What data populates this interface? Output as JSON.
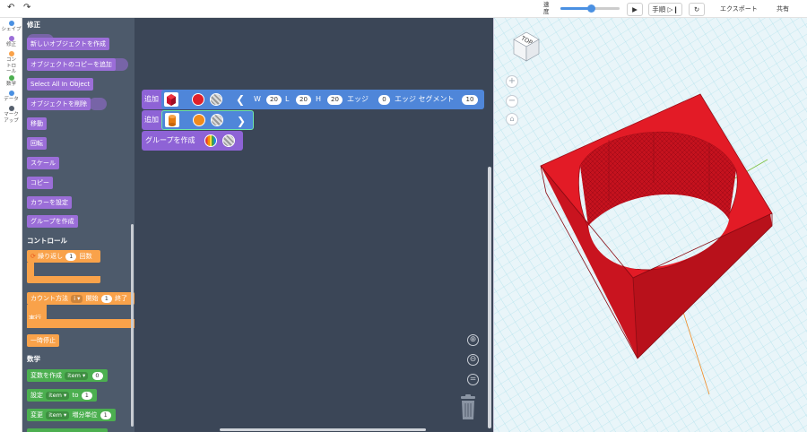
{
  "toolbar": {
    "undo_icon": "undo-arrow",
    "redo_icon": "redo-arrow",
    "speed_label": "速度",
    "speed_percent": 52,
    "play_icon": "play-triangle",
    "step_label": "手順",
    "step_icon": "step-forward",
    "reset_icon": "reset-circle",
    "export_label": "エクスポート",
    "share_label": "共有"
  },
  "categories": [
    {
      "label": "シェイプ",
      "color": "#4a90e2"
    },
    {
      "label": "修正",
      "color": "#9b6ed8"
    },
    {
      "label": "コントロール",
      "color": "#f9a24a"
    },
    {
      "label": "数学",
      "color": "#4caf50"
    },
    {
      "label": "データ",
      "color": "#4a90e2"
    },
    {
      "label": "マークアップ",
      "color": "#555f6d"
    }
  ],
  "flyout": {
    "modify_title": "修正",
    "modify_blocks": [
      "新しいオブジェクトを作成",
      "オブジェクトのコピーを追加",
      "Select All In Object",
      "オブジェクトを削除",
      "移動",
      "回転",
      "スケール",
      "コピー",
      "カラーを設定",
      "グループを作成"
    ],
    "control_title": "コントロール",
    "repeat_label": "繰り返し",
    "repeat_count": "1",
    "repeat_suffix": "回数",
    "count_label": "カウント方法",
    "count_var": "i",
    "count_from_label": "開始",
    "count_from": "1",
    "count_to_label": "終了",
    "count_do_label": "実行",
    "pause_label": "一時停止",
    "math_title": "数学",
    "var_create_label": "変数を作成",
    "var_create_name": "item",
    "var_create_value": "0",
    "set_label": "設定",
    "set_var": "item",
    "set_to_label": "to",
    "set_value": "1",
    "change_label": "変更",
    "change_var": "item",
    "change_by_label": "増分単位",
    "change_value": "1"
  },
  "workspace": {
    "add_label": "追加",
    "box": {
      "thumb_icon": "red-cube-icon",
      "color": "#e0202a",
      "w_label": "W",
      "w": "20",
      "l_label": "L",
      "l": "20",
      "h_label": "H",
      "h": "20",
      "edge_label": "エッジ",
      "edge": "0",
      "segments_label": "エッジ セグメント",
      "segments": "10"
    },
    "cylinder": {
      "thumb_icon": "orange-cylinder-icon",
      "color": "#f08a1c"
    },
    "group_label": "グループを作成",
    "zoom_in_icon": "zoom-in",
    "zoom_out_icon": "zoom-out",
    "recenter_label": "=",
    "trash_icon": "trash-can"
  },
  "viewport": {
    "view_cube_label": "TOP",
    "zoom_in_label": "+",
    "zoom_out_label": "−",
    "home_icon": "home-view",
    "object_color": "#e0202a"
  }
}
